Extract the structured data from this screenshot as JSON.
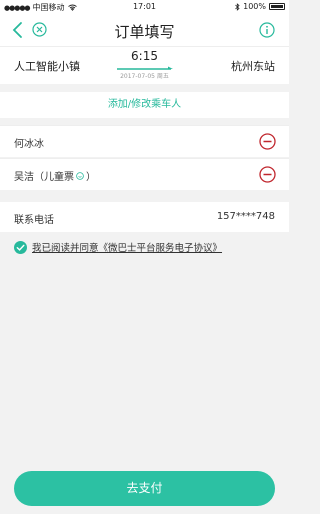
{
  "status_bar": {
    "carrier": "中国移动",
    "time": "17:01",
    "battery": "100%"
  },
  "nav": {
    "title": "订单填写"
  },
  "trip": {
    "from": "人工智能小镇",
    "to": "杭州东站",
    "time": "6:15",
    "date": "2017-07-05  周五"
  },
  "add_passenger": "添加/修改乘车人",
  "passengers": [
    {
      "name": "何冰冰",
      "ticket_type": ""
    },
    {
      "name": "吴洁（儿童票",
      "ticket_type": "）"
    }
  ],
  "contact": {
    "label": "联系电话",
    "value": "157****748"
  },
  "agreement": "我已阅读并同意《微巴士平台服务电子协议》",
  "pay_button": "去支付",
  "colors": {
    "accent": "#27b99c",
    "danger": "#c0262d",
    "button": "#2cc1a3"
  },
  "icons": [
    "back-icon",
    "close-circle-icon",
    "info-icon",
    "remove-icon",
    "child-ticket-icon",
    "check-circle-icon",
    "wifi-icon",
    "battery-icon",
    "bluetooth-icon"
  ]
}
